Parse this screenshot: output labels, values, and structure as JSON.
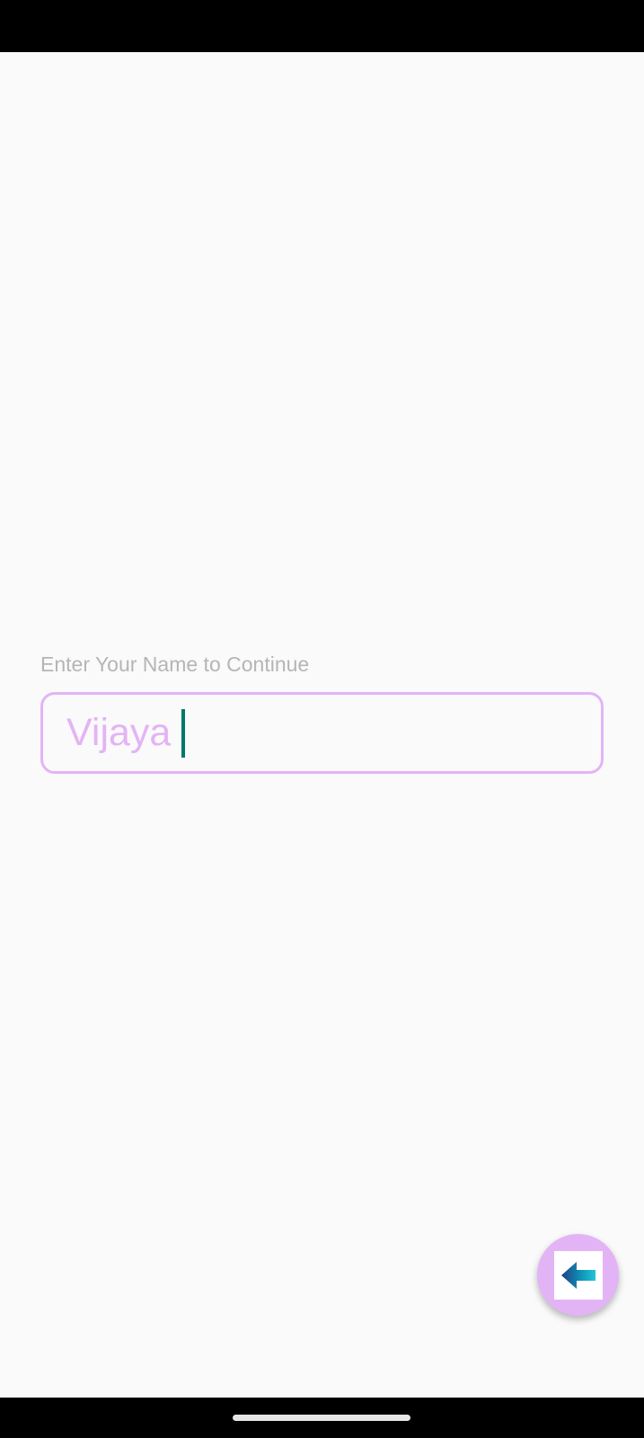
{
  "name_prompt": {
    "label": "Enter Your Name to Continue",
    "value": "Vijaya"
  },
  "back_button": {
    "icon": "arrow-left-icon"
  },
  "colors": {
    "accent": "#e3b4f5",
    "caret": "#00796b",
    "label": "#b5b5b5",
    "background": "#fafafa"
  }
}
